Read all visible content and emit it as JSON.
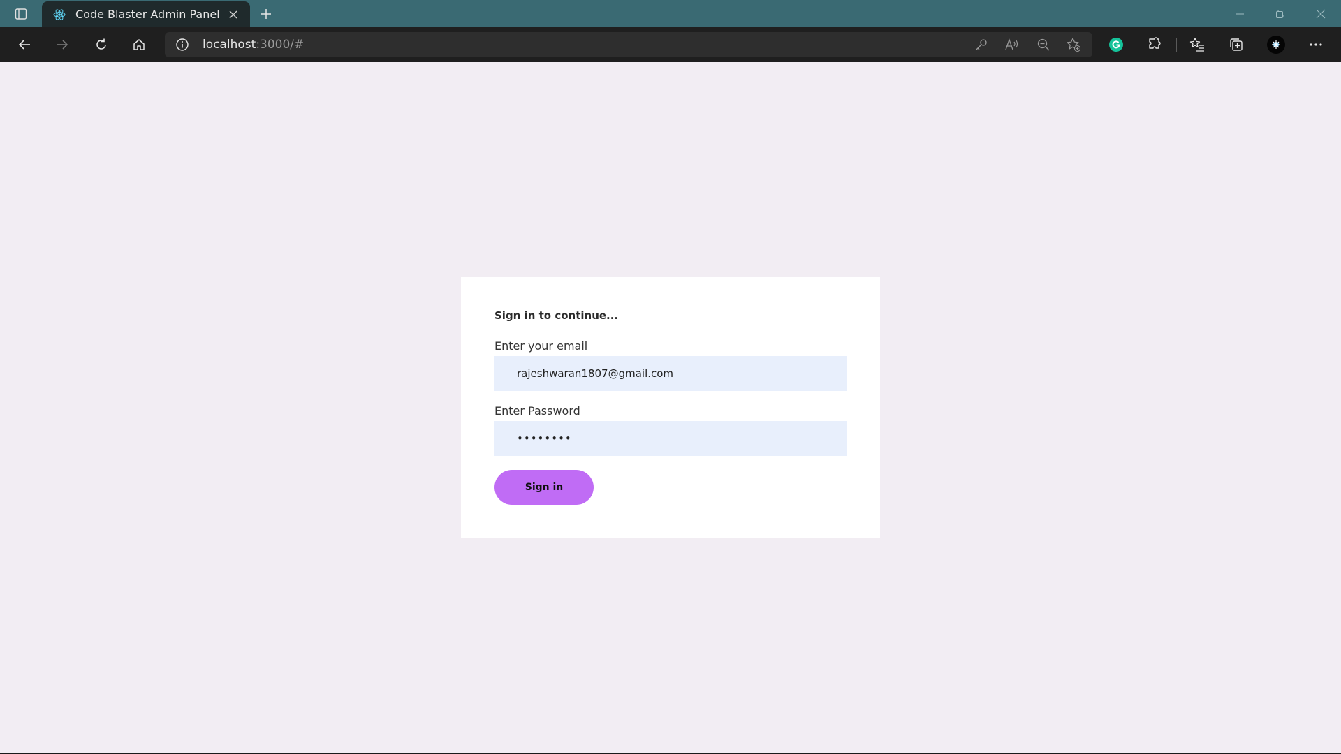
{
  "browser": {
    "tab": {
      "title": "Code Blaster Admin Panel",
      "icon": "react-icon"
    },
    "address_bar": {
      "url_host": "localhost",
      "url_rest": ":3000/#"
    },
    "colors": {
      "titlebar": "#3a6a73",
      "toolbar": "#1f1f1f",
      "grammarly": "#15c39a"
    }
  },
  "login": {
    "heading": "Sign in to continue...",
    "email_label": "Enter your email",
    "email_value": "rajeshwaran1807@gmail.com",
    "password_label": "Enter Password",
    "password_value": "••••••••",
    "submit_label": "Sign in",
    "colors": {
      "page_bg": "#f2edf3",
      "input_bg": "#e8effc",
      "button": "#c06cf5"
    }
  }
}
